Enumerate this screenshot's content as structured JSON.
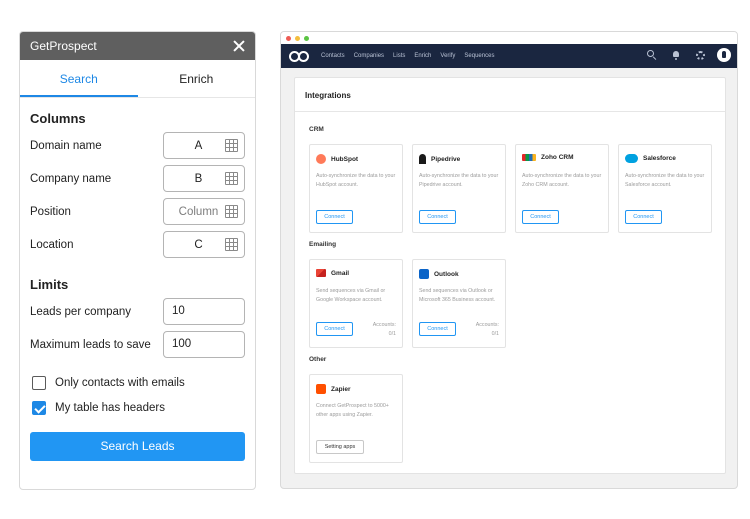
{
  "panel": {
    "title": "GetProspect",
    "tabs": [
      {
        "label": "Search",
        "active": true
      },
      {
        "label": "Enrich",
        "active": false
      }
    ],
    "columns_title": "Columns",
    "columns": [
      {
        "label": "Domain name",
        "value": "A",
        "placeholder": false
      },
      {
        "label": "Company name",
        "value": "B",
        "placeholder": false
      },
      {
        "label": "Position",
        "value": "Column",
        "placeholder": true
      },
      {
        "label": "Location",
        "value": "C",
        "placeholder": false
      }
    ],
    "limits_title": "Limits",
    "limits": [
      {
        "label": "Leads per company",
        "value": "10"
      },
      {
        "label": "Maximum leads to save",
        "value": "100"
      }
    ],
    "checks": [
      {
        "label": "Only contacts with emails",
        "checked": false
      },
      {
        "label": "My table has headers",
        "checked": true
      }
    ],
    "search_button": "Search Leads",
    "accent_color": "#2196f3"
  },
  "app": {
    "nav": [
      "Contacts",
      "Companies",
      "Lists",
      "Enrich",
      "Verify",
      "Sequences"
    ],
    "page_title": "Integrations",
    "groups": {
      "crm": {
        "label": "CRM",
        "cards": [
          {
            "name": "HubSpot",
            "icon": "hubspot-icon",
            "color": "#ff7a59",
            "desc": "Auto-synchronize the data to your HubSpot account.",
            "button": "Connect"
          },
          {
            "name": "Pipedrive",
            "icon": "pipedrive-icon",
            "color": "#1a1a1a",
            "desc": "Auto-synchronize the data to your Pipedrive account.",
            "button": "Connect"
          },
          {
            "name": "Zoho CRM",
            "icon": "zoho-icon",
            "color": "#e42527",
            "desc": "Auto-synchronize the data to your Zoho CRM account.",
            "button": "Connect"
          },
          {
            "name": "Salesforce",
            "icon": "salesforce-cloud-icon",
            "color": "#00a1e0",
            "desc": "Auto-synchronize the data to your Salesforce account.",
            "button": "Connect"
          }
        ]
      },
      "emailing": {
        "label": "Emailing",
        "cards": [
          {
            "name": "Gmail",
            "icon": "gmail-icon",
            "color": "#ea4335",
            "desc": "Send sequences via Gmail or Google Workspace account.",
            "button": "Connect",
            "accounts_label": "Accounts:",
            "accounts_value": "0/1"
          },
          {
            "name": "Outlook",
            "icon": "outlook-icon",
            "color": "#0a64c8",
            "desc": "Send sequences via Outlook or Microsoft 365 Business account.",
            "button": "Connect",
            "accounts_label": "Accounts:",
            "accounts_value": "0/1"
          }
        ]
      },
      "other": {
        "label": "Other",
        "cards": [
          {
            "name": "Zapier",
            "icon": "zapier-icon",
            "color": "#ff4f00",
            "desc": "Connect GetProspect to 5000+ other apps using Zapier.",
            "button": "Setting apps"
          }
        ]
      }
    }
  }
}
